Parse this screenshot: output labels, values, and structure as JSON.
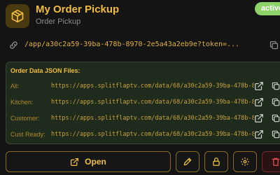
{
  "header": {
    "title": "My Order Pickup",
    "subtitle": "Order Pickup",
    "status": "active"
  },
  "url": {
    "text": "/app/a30c2a59-39ba-478b-8970-2e5a43a2eb9e?token=..."
  },
  "json_files": {
    "heading": "Order Data JSON Files:",
    "rows": [
      {
        "label": "All:",
        "url": "https://apps.splitflaptv.com/data/68/a30c2a59-39ba-478b-8970-..."
      },
      {
        "label": "Kitchen:",
        "url": "https://apps.splitflaptv.com/data/68/a30c2a59-39ba-478b-8970-..."
      },
      {
        "label": "Customer:",
        "url": "https://apps.splitflaptv.com/data/68/a30c2a59-39ba-478b-8970-..."
      },
      {
        "label": "Cust Ready:",
        "url": "https://apps.splitflaptv.com/data/68/a30c2a59-39ba-478b-8970-..."
      }
    ]
  },
  "actions": {
    "open_label": "Open"
  },
  "colors": {
    "accent": "#f2bd3a",
    "status": "#8ed36a",
    "panel": "#1f2b1c",
    "danger": "#e05252"
  },
  "icons": [
    "box-icon",
    "link-icon",
    "copy-icon",
    "external-link-icon",
    "pencil-icon",
    "lock-icon",
    "gear-icon",
    "trash-icon"
  ]
}
